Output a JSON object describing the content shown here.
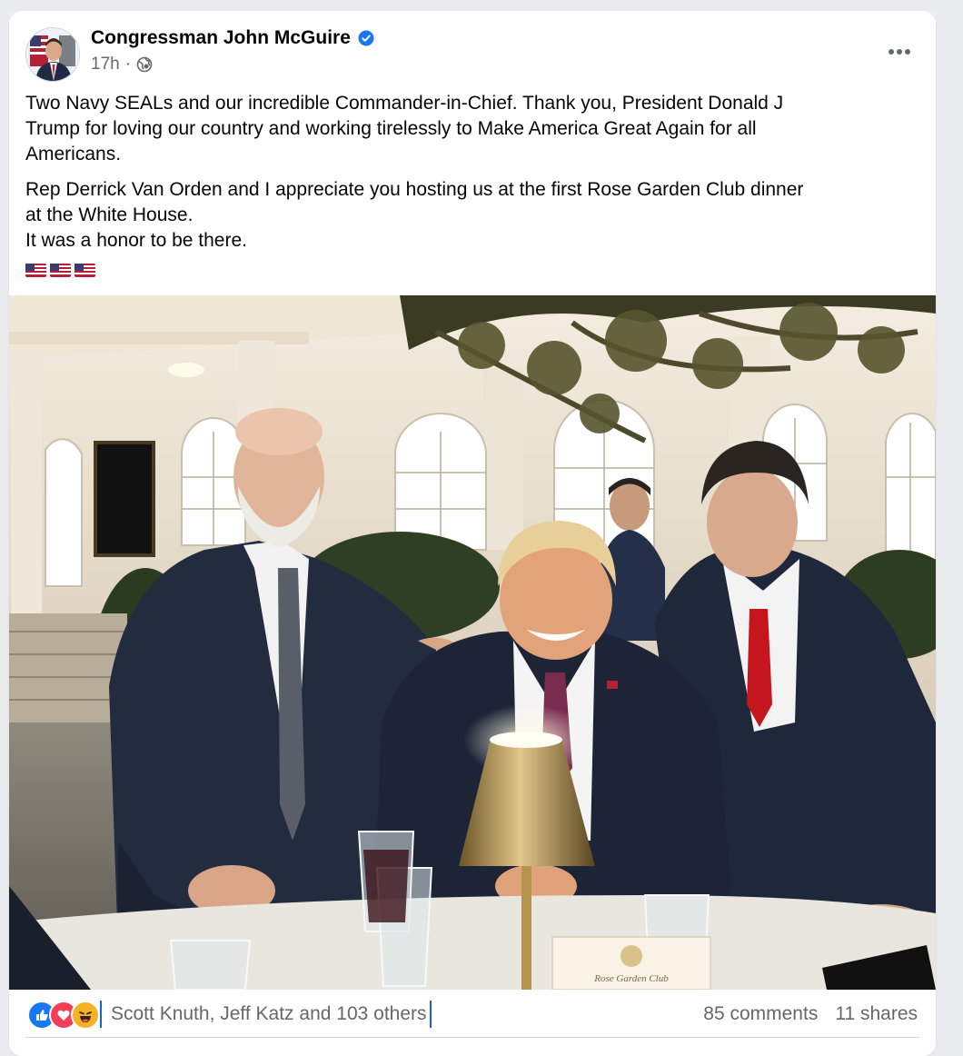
{
  "post": {
    "author": "Congressman John McGuire",
    "verified_icon": "verified-badge-icon",
    "time": "17h",
    "separator": "·",
    "privacy_icon": "globe-icon",
    "more_icon": "more-options-icon",
    "paragraph1_lines": [
      "Two Navy SEALs and our incredible Commander-in-Chief. Thank you, President Donald J",
      "Trump for loving our country and working tirelessly to Make America Great Again for all",
      "Americans."
    ],
    "paragraph2_lines": [
      "Rep Derrick Van Orden and I appreciate you hosting us at the first Rose Garden Club dinner",
      "at the White House.",
      "It was a honor to be there."
    ],
    "flag_emoji": [
      "🇺🇸",
      "🇺🇸",
      "🇺🇸"
    ],
    "photo_card_text": "Rose Garden Club"
  },
  "reactions": {
    "icons": [
      "like-icon",
      "love-icon",
      "haha-icon"
    ],
    "reactors_text": "Scott Knuth, Jeff Katz and 103 others",
    "comments": "85 comments",
    "shares": "11 shares"
  },
  "colors": {
    "text": "#050505",
    "secondary": "#65676b",
    "like_blue": "#1877f2",
    "love_red": "#f33e58",
    "haha_yellow": "#f7b125"
  }
}
